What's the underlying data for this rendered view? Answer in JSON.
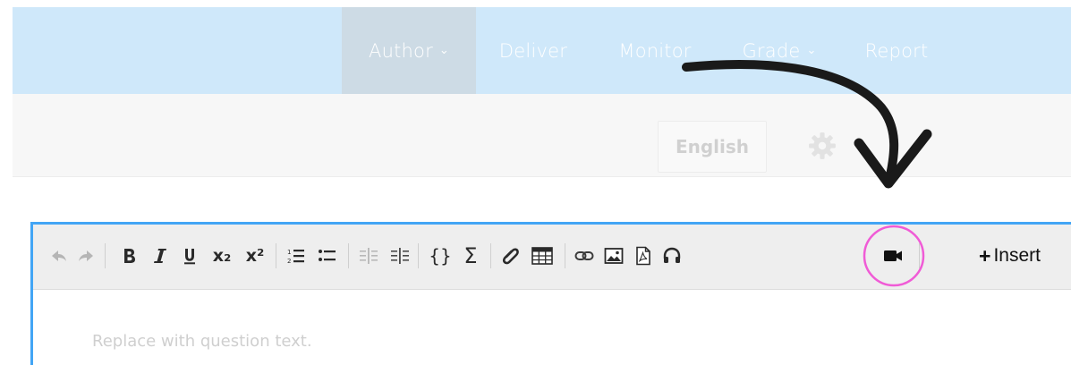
{
  "nav": {
    "items": [
      {
        "label": "Author",
        "dropdown": true,
        "active": true
      },
      {
        "label": "Deliver",
        "dropdown": false
      },
      {
        "label": "Monitor",
        "dropdown": false
      },
      {
        "label": "Grade",
        "dropdown": true
      },
      {
        "label": "Report",
        "dropdown": false
      }
    ]
  },
  "language": {
    "label": "English"
  },
  "toolbar": {
    "subscript": "x₂",
    "superscript": "x²",
    "braces": "{}",
    "sum": "Σ",
    "insert_plus": "+",
    "insert_label": "Insert"
  },
  "editor": {
    "placeholder": "Replace with question text."
  },
  "colors": {
    "nav_bg": "#cfe8fa",
    "active_tab": "#cddbe5",
    "editor_border": "#42a5f5",
    "highlight_circle": "#f05bd6",
    "arrow": "#1a1a1a"
  },
  "highlight": {
    "target": "video-icon"
  }
}
